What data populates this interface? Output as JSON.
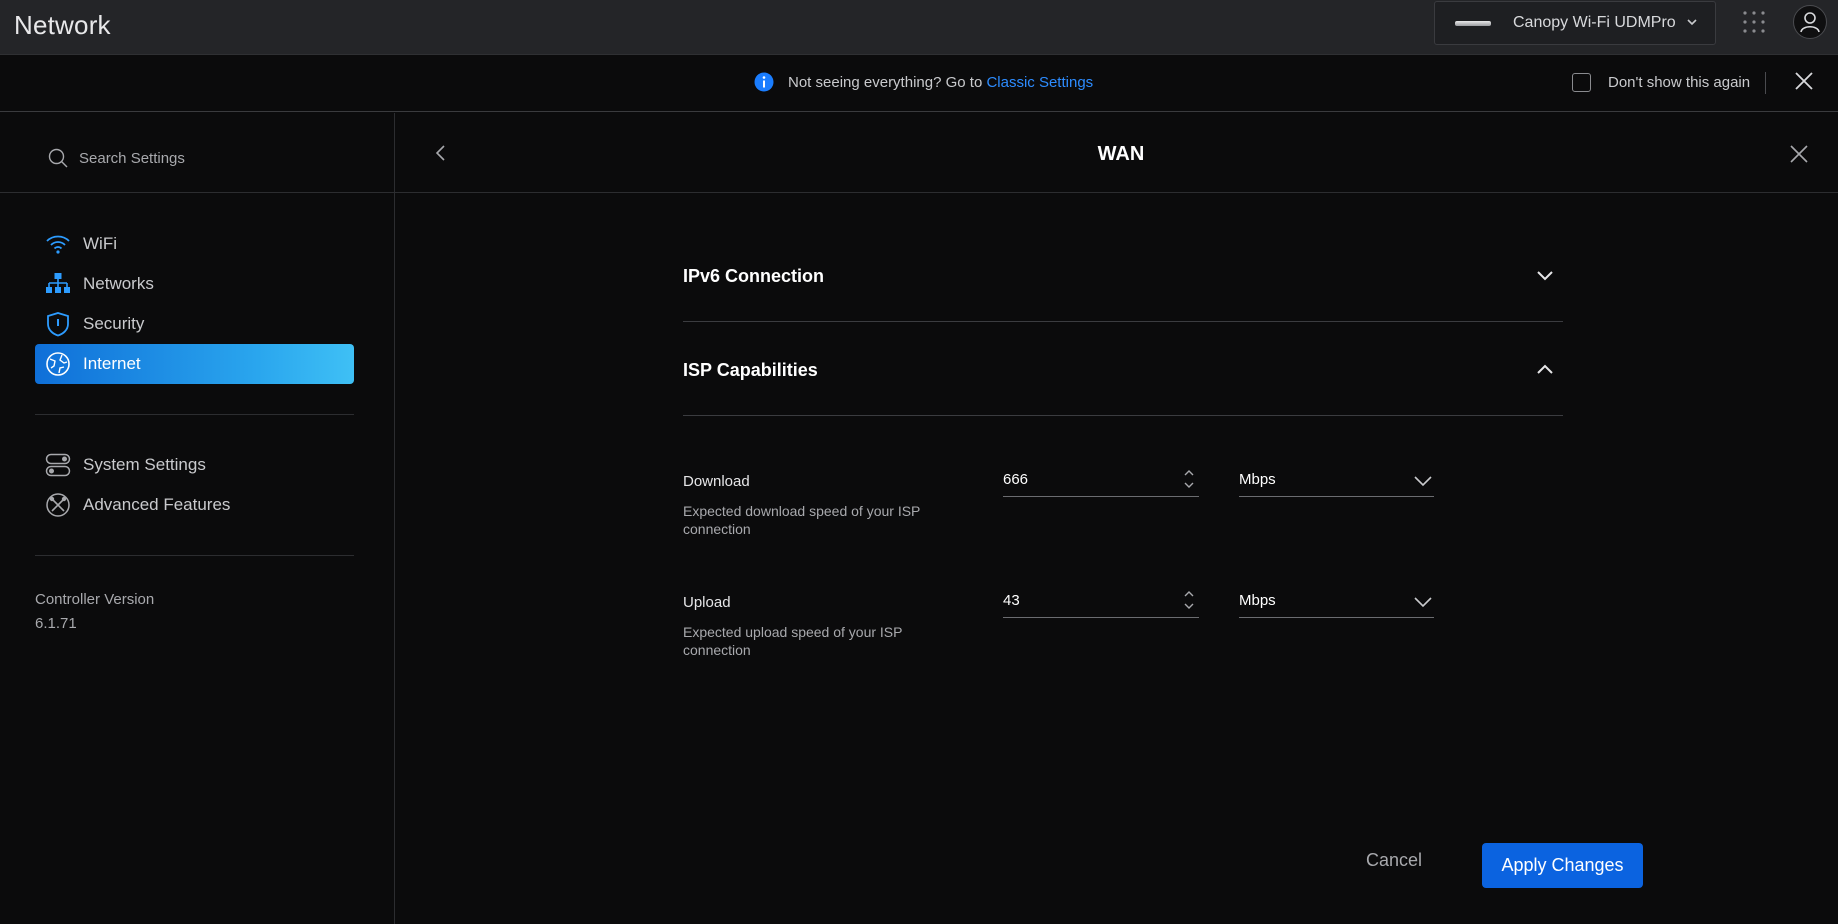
{
  "app": {
    "title": "Network"
  },
  "device": {
    "name": "Canopy Wi-Fi UDMPro"
  },
  "banner": {
    "text": "Not seeing everything? Go to ",
    "link": "Classic Settings",
    "checkbox_label": "Don't show this again"
  },
  "sidebar": {
    "search_placeholder": "Search Settings",
    "items": [
      {
        "label": "WiFi",
        "icon": "wifi-icon"
      },
      {
        "label": "Networks",
        "icon": "networks-icon"
      },
      {
        "label": "Security",
        "icon": "shield-icon"
      },
      {
        "label": "Internet",
        "icon": "globe-icon",
        "active": true
      }
    ],
    "items2": [
      {
        "label": "System Settings",
        "icon": "toggles-icon"
      },
      {
        "label": "Advanced Features",
        "icon": "tools-icon"
      }
    ],
    "controller_label": "Controller Version",
    "controller_version": "6.1.71"
  },
  "panel": {
    "title": "WAN",
    "sections": [
      {
        "title": "IPv6 Connection",
        "expanded": false
      },
      {
        "title": "ISP Capabilities",
        "expanded": true
      }
    ],
    "fields": {
      "download": {
        "label": "Download",
        "desc": "Expected download speed of your ISP connection",
        "value": "666",
        "unit": "Mbps"
      },
      "upload": {
        "label": "Upload",
        "desc": "Expected upload speed of your ISP connection",
        "value": "43",
        "unit": "Mbps"
      }
    },
    "cancel_label": "Cancel",
    "apply_label": "Apply Changes"
  },
  "colors": {
    "accent": "#0b63e0",
    "link": "#2d8cff",
    "active_nav_start": "#0f6fd8",
    "active_nav_end": "#3fc0f5"
  }
}
